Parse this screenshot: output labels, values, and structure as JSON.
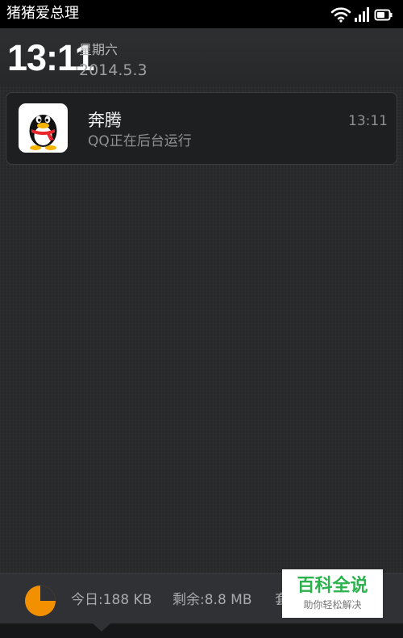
{
  "status_bar": {
    "carrier": "猪猪爱总理",
    "icons": [
      "wifi-icon",
      "signal-icon",
      "battery-icon"
    ]
  },
  "header": {
    "time": "13:11",
    "weekday": "星期六",
    "date": "2014.5.3"
  },
  "notification": {
    "app_icon": "qq-penguin-icon",
    "title": "奔腾",
    "text": "QQ正在后台运行",
    "time": "13:11"
  },
  "traffic": {
    "pie_icon": "data-usage-pie-icon",
    "usage_fraction": 0.75,
    "today": "今日:188 KB",
    "remaining": "剩余:8.8 MB",
    "cut_text": "套"
  },
  "watermark": {
    "title": "百科全说",
    "subtitle": "助你轻松解决"
  },
  "colors": {
    "panel_background": "#27282a",
    "card_background": "#1e1f21",
    "pie_orange": "#f39000",
    "watermark_green": "#2bb24c"
  }
}
